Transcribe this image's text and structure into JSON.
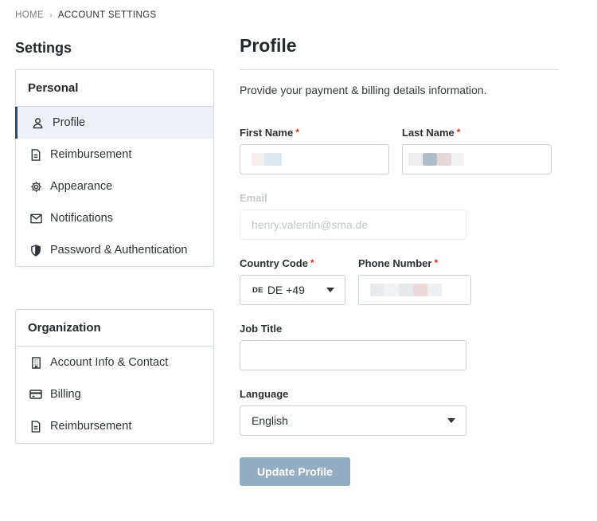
{
  "breadcrumb": {
    "home": "HOME",
    "current": "ACCOUNT SETTINGS"
  },
  "sidebar": {
    "title": "Settings",
    "personal": {
      "header": "Personal",
      "items": [
        {
          "label": "Profile",
          "icon": "user-icon",
          "active": true
        },
        {
          "label": "Reimbursement",
          "icon": "document-icon"
        },
        {
          "label": "Appearance",
          "icon": "gear-icon"
        },
        {
          "label": "Notifications",
          "icon": "mail-icon"
        },
        {
          "label": "Password & Authentication",
          "icon": "shield-icon"
        }
      ]
    },
    "organization": {
      "header": "Organization",
      "items": [
        {
          "label": "Account Info & Contact",
          "icon": "building-icon"
        },
        {
          "label": "Billing",
          "icon": "credit-card-icon"
        },
        {
          "label": "Reimbursement",
          "icon": "document-icon"
        }
      ]
    }
  },
  "main": {
    "title": "Profile",
    "description": "Provide your payment & billing details information.",
    "form": {
      "first_name": {
        "label": "First Name",
        "required": "*"
      },
      "last_name": {
        "label": "Last Name",
        "required": "*"
      },
      "email": {
        "label": "Email",
        "value": "henry.valentin@sma.de"
      },
      "country_code": {
        "label": "Country Code",
        "required": "*",
        "flag": "DE",
        "value": "DE +49"
      },
      "phone_number": {
        "label": "Phone Number",
        "required": "*"
      },
      "job_title": {
        "label": "Job Title",
        "value": ""
      },
      "language": {
        "label": "Language",
        "value": "English"
      }
    },
    "update_button": "Update Profile"
  },
  "colors": {
    "accent": "#2c4a66",
    "active_bg": "#eef2f6",
    "required": "#d93025",
    "button_disabled": "#93aec4"
  }
}
